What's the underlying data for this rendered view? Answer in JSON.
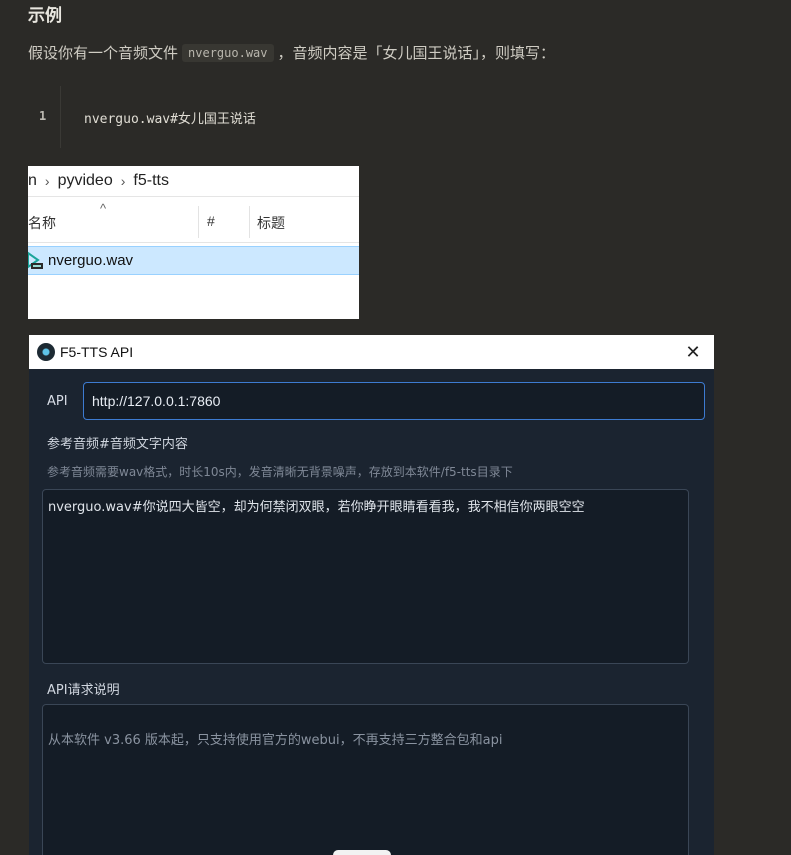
{
  "doc": {
    "heading": "示例",
    "para_before": "假设你有一个音频文件",
    "inline_code": "nverguo.wav",
    "para_after": "，音频内容是「女儿国王说话」，则填写：",
    "code_line_number": "1",
    "code_line": "nverguo.wav#女儿国王说话"
  },
  "explorer": {
    "breadcrumbs": [
      "n",
      "pyvideo",
      "f5-tts"
    ],
    "columns": {
      "name": "名称",
      "number": "#",
      "title": "标题"
    },
    "file": {
      "name": "nverguo.wav",
      "icon": "audio-file-icon"
    }
  },
  "dialog": {
    "title": "F5-TTS API",
    "close_glyph": "✕",
    "api_label": "API",
    "api_value": "http://127.0.0.1:7860",
    "ref_label": "参考音频#音频文字内容",
    "ref_hint": "参考音频需要wav格式，时长10s内，发音清晰无背景噪声，存放到本软件/f5-tts目录下",
    "ref_value": "nverguo.wav#你说四大皆空，却为何禁闭双眼，若你睁开眼睛看看我，我不相信你两眼空空",
    "apidoc_label": "API请求说明",
    "apidoc_text": "从本软件 v3.66 版本起，只支持使用官方的webui，不再支持三方整合包和api"
  },
  "colors": {
    "page_bg": "#2b2a27",
    "dialog_bg": "#1b2430",
    "input_focus_border": "#3d7bd1",
    "selection_bg": "#cce8ff"
  }
}
